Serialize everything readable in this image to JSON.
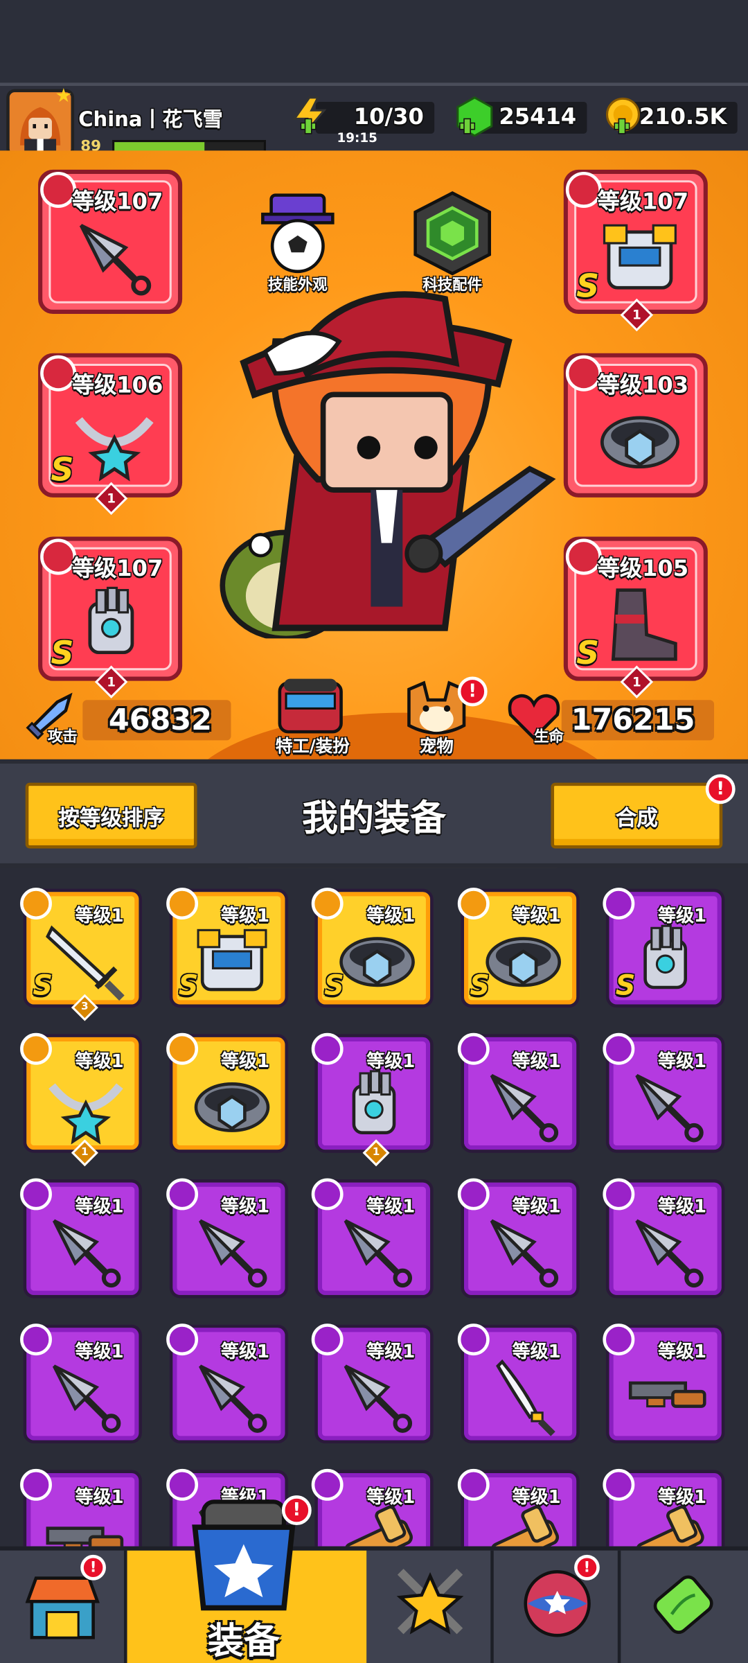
{
  "profile": {
    "name": "China丨花飞雪",
    "level": "89",
    "xp_fraction": 0.6
  },
  "resources": {
    "energy": {
      "value": "10/30",
      "timer": "19:15"
    },
    "gems": {
      "value": "25414"
    },
    "coins": {
      "value": "210.5K"
    }
  },
  "hero": {
    "left_slots": [
      {
        "label": "等级107",
        "rank": "",
        "count": "",
        "icon": "kunai-icon"
      },
      {
        "label": "等级106",
        "rank": "S",
        "count": "1",
        "icon": "necklace-icon"
      },
      {
        "label": "等级107",
        "rank": "S",
        "count": "1",
        "icon": "gauntlet-icon"
      }
    ],
    "right_slots": [
      {
        "label": "等级107",
        "rank": "S",
        "count": "1",
        "icon": "armor-icon"
      },
      {
        "label": "等级103",
        "rank": "",
        "count": "",
        "icon": "belt-icon"
      },
      {
        "label": "等级105",
        "rank": "S",
        "count": "1",
        "icon": "boot-icon"
      }
    ],
    "skill_skin": "技能外观",
    "tech_parts": "科技配件",
    "agent_outfit": "特工/装扮",
    "pet": "宠物",
    "attack_label": "攻击",
    "attack_value": "46832",
    "hp_label": "生命",
    "hp_value": "176215"
  },
  "equipment": {
    "sort_button": "按等级排序",
    "title": "我的装备",
    "merge_button": "合成",
    "items": [
      {
        "label": "等级1",
        "tier": "gold",
        "rank": "S",
        "count": "3",
        "icon": "sword-icon"
      },
      {
        "label": "等级1",
        "tier": "gold",
        "rank": "S",
        "count": "",
        "icon": "armor-icon"
      },
      {
        "label": "等级1",
        "tier": "gold",
        "rank": "S",
        "count": "",
        "icon": "belt-icon"
      },
      {
        "label": "等级1",
        "tier": "gold",
        "rank": "S",
        "count": "",
        "icon": "belt-icon"
      },
      {
        "label": "等级1",
        "tier": "purple",
        "rank": "S",
        "count": "",
        "icon": "gauntlet-icon"
      },
      {
        "label": "等级1",
        "tier": "gold",
        "rank": "",
        "count": "1",
        "icon": "necklace-icon"
      },
      {
        "label": "等级1",
        "tier": "gold",
        "rank": "",
        "count": "",
        "icon": "belt-icon"
      },
      {
        "label": "等级1",
        "tier": "purple",
        "rank": "",
        "count": "1",
        "icon": "gauntlet-icon"
      },
      {
        "label": "等级1",
        "tier": "purple",
        "rank": "",
        "count": "",
        "icon": "kunai-icon"
      },
      {
        "label": "等级1",
        "tier": "purple",
        "rank": "",
        "count": "",
        "icon": "kunai-icon"
      },
      {
        "label": "等级1",
        "tier": "purple",
        "rank": "",
        "count": "",
        "icon": "kunai-icon"
      },
      {
        "label": "等级1",
        "tier": "purple",
        "rank": "",
        "count": "",
        "icon": "kunai-icon"
      },
      {
        "label": "等级1",
        "tier": "purple",
        "rank": "",
        "count": "",
        "icon": "kunai-icon"
      },
      {
        "label": "等级1",
        "tier": "purple",
        "rank": "",
        "count": "",
        "icon": "kunai-icon"
      },
      {
        "label": "等级1",
        "tier": "purple",
        "rank": "",
        "count": "",
        "icon": "kunai-icon"
      },
      {
        "label": "等级1",
        "tier": "purple",
        "rank": "",
        "count": "",
        "icon": "kunai-icon"
      },
      {
        "label": "等级1",
        "tier": "purple",
        "rank": "",
        "count": "",
        "icon": "kunai-icon"
      },
      {
        "label": "等级1",
        "tier": "purple",
        "rank": "",
        "count": "",
        "icon": "kunai-icon"
      },
      {
        "label": "等级1",
        "tier": "purple",
        "rank": "",
        "count": "",
        "icon": "katana-icon"
      },
      {
        "label": "等级1",
        "tier": "purple",
        "rank": "",
        "count": "",
        "icon": "shotgun-icon"
      },
      {
        "label": "等级1",
        "tier": "purple",
        "rank": "",
        "count": "",
        "icon": "shotgun-icon"
      },
      {
        "label": "等级1",
        "tier": "purple",
        "rank": "",
        "count": "",
        "icon": "kunai-icon"
      },
      {
        "label": "等级1",
        "tier": "purple",
        "rank": "",
        "count": "",
        "icon": "bazooka-icon"
      },
      {
        "label": "等级1",
        "tier": "purple",
        "rank": "",
        "count": "",
        "icon": "bazooka-icon"
      },
      {
        "label": "等级1",
        "tier": "purple",
        "rank": "",
        "count": "",
        "icon": "bazooka-icon"
      }
    ]
  },
  "nav": {
    "active_label": "装备"
  },
  "colors": {
    "gold": "#ffd02a",
    "purple": "#b43ae0",
    "slot_red": "#ff3d52",
    "hero_bg": "#ff9a1a"
  }
}
